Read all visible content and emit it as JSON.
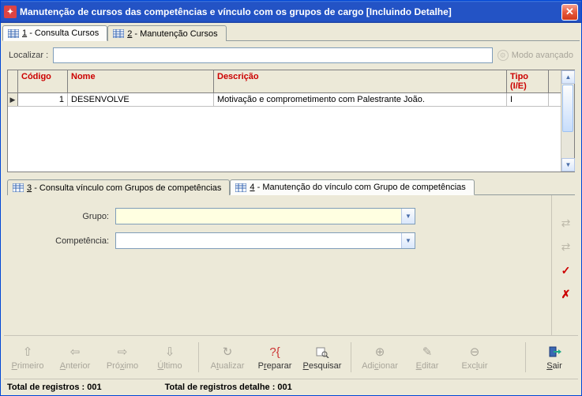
{
  "window": {
    "title": "Manutenção de cursos das competências e vínculo com os grupos de cargo [Incluindo Detalhe]"
  },
  "tabs_top": [
    {
      "key": "1",
      "label": "- Consulta Cursos"
    },
    {
      "key": "2",
      "label": "- Manutenção Cursos"
    }
  ],
  "search": {
    "label": "Localizar :",
    "value": "",
    "adv_label": "Modo avançado"
  },
  "grid": {
    "headers": {
      "codigo": "Código",
      "nome": "Nome",
      "descricao": "Descrição",
      "tipo": "Tipo (I/E)"
    },
    "rows": [
      {
        "codigo": "1",
        "nome": "DESENVOLVE",
        "descricao": "Motivação e comprometimento com Palestrante João.",
        "tipo": "I"
      }
    ]
  },
  "tabs_bottom": [
    {
      "key": "3",
      "label": "- Consulta vínculo com Grupos de competências"
    },
    {
      "key": "4",
      "label": "- Manutenção do vínculo com Grupo de competências"
    }
  ],
  "form": {
    "grupo_label": "Grupo:",
    "grupo_value": "",
    "competencia_label": "Competência:",
    "competencia_value": ""
  },
  "toolbar": {
    "primeiro": "Primeiro",
    "anterior": "Anterior",
    "proximo": "Próximo",
    "ultimo": "Último",
    "atualizar": "Atualizar",
    "preparar": "Preparar",
    "pesquisar": "Pesquisar",
    "adicionar": "Adicionar",
    "editar": "Editar",
    "excluir": "Excluir",
    "sair": "Sair"
  },
  "status": {
    "total_reg": "Total de registros : 001",
    "total_det": "Total de registros detalhe : 001"
  }
}
